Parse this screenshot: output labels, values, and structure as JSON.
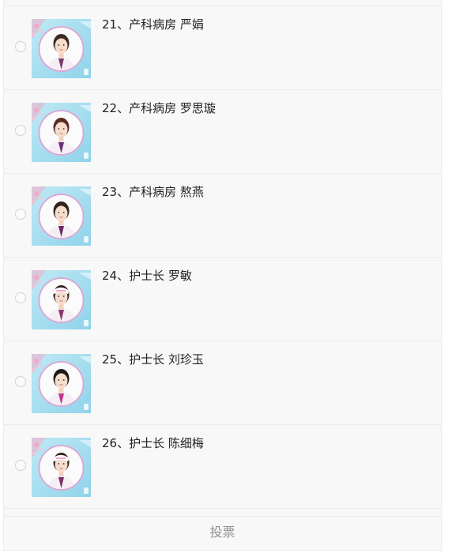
{
  "candidates": [
    {
      "label": "21、产科病房 严娟",
      "cap": "none",
      "hair": "#3a2a22",
      "tie": "#7a3b6e"
    },
    {
      "label": "22、产科病房 罗思璇",
      "cap": "none",
      "hair": "#5a2a26",
      "tie": "#6a2d74"
    },
    {
      "label": "23、产科病房 熬燕",
      "cap": "none",
      "hair": "#2e241c",
      "tie": "#6e2a5e"
    },
    {
      "label": "24、护士长 罗敏",
      "cap": "nurse-cap",
      "hair": "#2b2019",
      "tie": "#8b3a6a"
    },
    {
      "label": "25、护士长 刘珍玉",
      "cap": "none",
      "hair": "#1f1916",
      "tie": "#c0368a"
    },
    {
      "label": "26、护士长 陈细梅",
      "cap": "nurse-cap",
      "hair": "#241b16",
      "tie": "#7a2f66"
    }
  ],
  "footer": {
    "vote_label": "投票"
  },
  "colors": {
    "photo_bg_top": "#bfe9f5",
    "photo_bg_bottom": "#8fd3ea",
    "ring": "#d9a7d6",
    "blossom": "#f2a9c4"
  }
}
